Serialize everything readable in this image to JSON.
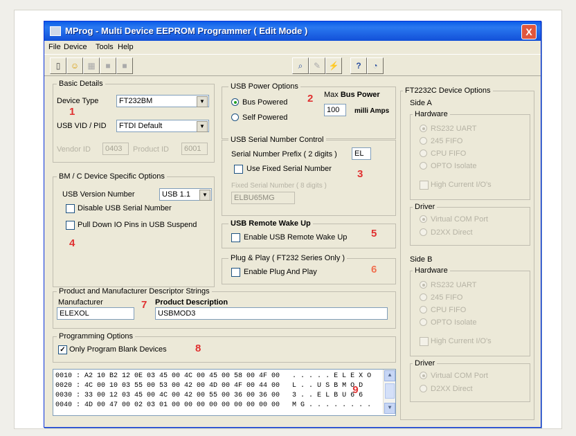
{
  "window": {
    "title": "MProg - Multi Device EEPROM Programmer ( Edit Mode )",
    "close": "X"
  },
  "menu": [
    "File",
    "Device",
    "Tools",
    "Help"
  ],
  "toolbar_icons": [
    "new-icon",
    "open-icon",
    "save-icon",
    "program-icon",
    "erase-icon",
    "search-icon",
    "read-icon",
    "flash-icon",
    "help-icon",
    "about-icon"
  ],
  "toolbar_glyphs": {
    "new": "▯",
    "open": "☺",
    "save": "▦",
    "program": "■",
    "erase": "■",
    "search": "⌕",
    "read": "✎",
    "flash": "⚡",
    "help": "?",
    "about": "◔"
  },
  "basic": {
    "title": "Basic Details",
    "device_type_label": "Device Type",
    "device_type": "FT232BM",
    "vidpid_label": "USB VID / PID",
    "vidpid": "FTDI Default",
    "vendor_label": "Vendor ID",
    "vendor": "0403",
    "product_label": "Product ID",
    "product": "6001",
    "marker": "1"
  },
  "bmc": {
    "title": "BM / C Device Specific Options",
    "usb_version_label": "USB Version Number",
    "usb_version": "USB 1.1",
    "disable_serial": "Disable USB Serial Number",
    "pulldown": "Pull Down IO Pins in USB Suspend",
    "marker": "4"
  },
  "power": {
    "title": "USB Power Options",
    "bus": "Bus Powered",
    "self": "Self Powered",
    "max_label_1": "Max",
    "max_label_2": "Bus Power",
    "max_value": "100",
    "unit": "milli Amps",
    "marker": "2"
  },
  "serial": {
    "title": "USB Serial Number Control",
    "prefix_label": "Serial Number Prefix ( 2 digits )",
    "prefix": "EL",
    "use_fixed": "Use Fixed Serial Number",
    "fixed_label": "Fixed Serial Number ( 8 digits )",
    "fixed_value": "ELBU65MG",
    "marker": "3"
  },
  "wake": {
    "title": "USB Remote Wake Up",
    "enable": "Enable USB Remote Wake Up",
    "marker": "5"
  },
  "pnp": {
    "title": "Plug & Play  ( FT232 Series Only )",
    "enable": "Enable Plug And Play",
    "marker": "6"
  },
  "descriptors": {
    "title": "Product and Manufacturer Descriptor Strings",
    "manufacturer_label": "Manufacturer",
    "manufacturer": "ELEXOL",
    "product_label": "Product Description",
    "product": "USBMOD3",
    "marker": "7"
  },
  "programming": {
    "title": "Programming Options",
    "blank_only": "Only Program Blank Devices",
    "marker": "8"
  },
  "hex": {
    "lines": [
      "0010 : A2 10 B2 12 0E 03 45 00 4C 00 45 00 58 00 4F 00   . . . . . E L E X O",
      "0020 : 4C 00 10 03 55 00 53 00 42 00 4D 00 4F 00 44 00   L . . U S B M O D",
      "0030 : 33 00 12 03 45 00 4C 00 42 00 55 00 36 00 36 00   3 . . E L B U 6 6",
      "0040 : 4D 00 47 00 02 03 01 00 00 00 00 00 00 00 00 00   M G . . . . . . . ."
    ],
    "marker": "9"
  },
  "ft2232c": {
    "title": "FT2232C Device Options",
    "sideA": "Side A",
    "sideB": "Side B",
    "hardware": "Hardware",
    "driver": "Driver",
    "hw_options": [
      "RS232 UART",
      "245 FIFO",
      "CPU FIFO",
      "OPTO Isolate"
    ],
    "high_current": "High Current I/O's",
    "driver_options": [
      "Virtual COM Port",
      "D2XX Direct"
    ]
  }
}
